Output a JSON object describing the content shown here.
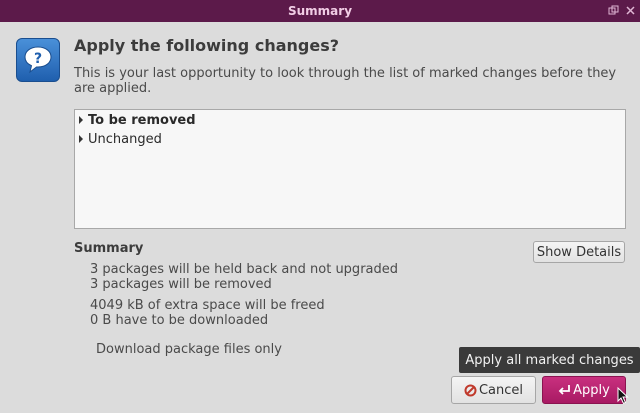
{
  "window": {
    "title": "Summary"
  },
  "header": {
    "heading": "Apply the following changes?",
    "description": "This is your last opportunity to look through the list of marked changes before they are applied."
  },
  "tree": {
    "items": [
      {
        "label": "To be removed",
        "bold": true
      },
      {
        "label": "Unchanged",
        "bold": false
      }
    ]
  },
  "summary": {
    "title": "Summary",
    "show_details_label": "Show Details",
    "lines": [
      "3 packages will be held back and not upgraded",
      "3 packages will be removed",
      "4049 kB of extra space will be freed",
      "0  B have to be downloaded"
    ],
    "download_only_label": "Download package files only"
  },
  "tooltip": {
    "text": "Apply all marked changes"
  },
  "buttons": {
    "cancel_label": "Cancel",
    "apply_label": "Apply"
  },
  "colors": {
    "titlebar": "#5c1a4a",
    "title_text": "#f1cde5",
    "accent": "#b8226f",
    "dialog_bg": "#dcdcdc"
  },
  "icons": {
    "dialog": "question-icon",
    "cancel": "cancel-icon",
    "apply": "return-arrow-icon",
    "restore": "restore-icon",
    "close": "close-icon"
  }
}
